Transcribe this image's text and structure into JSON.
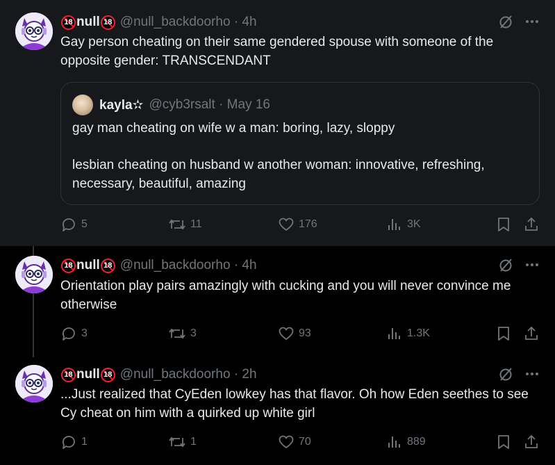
{
  "colors": {
    "background": "#000000",
    "highlight": "#16181c",
    "text": "#e7e9ea",
    "muted": "#71767b",
    "thread_line": "#333639",
    "badge": "#f4212e"
  },
  "tweets": [
    {
      "badge_left": "18",
      "display_name": "null",
      "badge_right": "18",
      "handle_meta": "@null_backdoorho · 4h",
      "text": "Gay person cheating on their same gendered spouse with someone of the opposite gender: TRANSCENDANT",
      "quote": {
        "display_name": "kayla✫",
        "handle_meta": "@cyb3rsalt · May 16",
        "paragraph_1": "gay man cheating on wife w a man: boring, lazy, sloppy",
        "paragraph_2": "lesbian cheating on husband w another woman: innovative, refreshing, necessary, beautiful, amazing"
      },
      "replies": "5",
      "reposts": "11",
      "likes": "176",
      "views": "3K"
    },
    {
      "badge_left": "18",
      "display_name": "null",
      "badge_right": "18",
      "handle_meta": "@null_backdoorho · 4h",
      "text": "Orientation play pairs amazingly with cucking and you will never convince me otherwise",
      "replies": "3",
      "reposts": "3",
      "likes": "93",
      "views": "1.3K"
    },
    {
      "badge_left": "18",
      "display_name": "null",
      "badge_right": "18",
      "handle_meta": "@null_backdoorho · 2h",
      "text": "...Just realized that CyEden lowkey has that flavor. Oh how Eden seethes to see Cy cheat on him with a quirked up white girl",
      "replies": "1",
      "reposts": "1",
      "likes": "70",
      "views": "889"
    }
  ]
}
